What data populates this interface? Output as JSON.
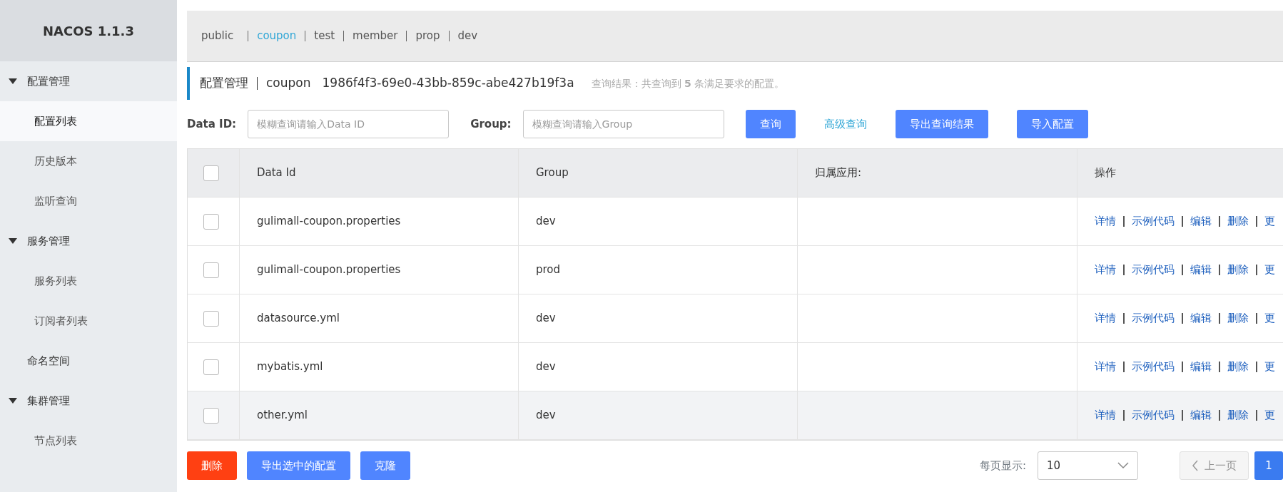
{
  "sidebar": {
    "title": "NACOS 1.1.3",
    "items": [
      {
        "label": "配置管理",
        "kind": "group",
        "expanded": true,
        "children": [
          {
            "label": "配置列表",
            "selected": true
          },
          {
            "label": "历史版本",
            "selected": false
          },
          {
            "label": "监听查询",
            "selected": false
          }
        ]
      },
      {
        "label": "服务管理",
        "kind": "group",
        "expanded": true,
        "children": [
          {
            "label": "服务列表",
            "selected": false
          },
          {
            "label": "订阅者列表",
            "selected": false
          }
        ]
      },
      {
        "label": "命名空间",
        "kind": "link",
        "selected": false
      },
      {
        "label": "集群管理",
        "kind": "group",
        "expanded": true,
        "children": [
          {
            "label": "节点列表",
            "selected": false
          }
        ]
      }
    ]
  },
  "namespaces": [
    {
      "label": "public",
      "selected": false
    },
    {
      "label": "coupon",
      "selected": true
    },
    {
      "label": "test",
      "selected": false
    },
    {
      "label": "member",
      "selected": false
    },
    {
      "label": "prop",
      "selected": false
    },
    {
      "label": "dev",
      "selected": false
    }
  ],
  "header": {
    "title": "配置管理",
    "namespace": "coupon",
    "namespace_id": "1986f4f3-69e0-43bb-859c-abe427b19f3a",
    "result": "查询结果：共查询到 **5** 条满足要求的配置。"
  },
  "filters": [
    {
      "label": "Data ID:",
      "placeholder": "模糊查询请输入Data ID"
    },
    {
      "label": "Group:",
      "placeholder": "模糊查询请输入Group"
    }
  ],
  "actions": [
    {
      "label": "查询",
      "kind": "primary"
    },
    {
      "label": "高级查询",
      "kind": "link"
    },
    {
      "label": "导出查询结果",
      "kind": "primary"
    },
    {
      "label": "导入配置",
      "kind": "primary"
    }
  ],
  "table": {
    "columns": [
      "Data Id",
      "Group",
      "归属应用:",
      "操作"
    ],
    "all_checked": false,
    "rows": [
      {
        "data_id": "gulimall-coupon.properties",
        "group": "dev",
        "checked": false,
        "hovered": false,
        "operations": [
          "详情",
          "示例代码",
          "编辑",
          "删除",
          "更"
        ]
      },
      {
        "data_id": "gulimall-coupon.properties",
        "group": "prod",
        "checked": false,
        "hovered": false,
        "operations": [
          "详情",
          "示例代码",
          "编辑",
          "删除",
          "更"
        ]
      },
      {
        "data_id": "datasource.yml",
        "group": "dev",
        "checked": false,
        "hovered": false,
        "operations": [
          "详情",
          "示例代码",
          "编辑",
          "删除",
          "更"
        ]
      },
      {
        "data_id": "mybatis.yml",
        "group": "dev",
        "checked": false,
        "hovered": false,
        "operations": [
          "详情",
          "示例代码",
          "编辑",
          "删除",
          "更"
        ]
      },
      {
        "data_id": "other.yml",
        "group": "dev",
        "checked": false,
        "hovered": true,
        "operations": [
          "详情",
          "示例代码",
          "编辑",
          "删除",
          "更"
        ]
      }
    ]
  },
  "bulk_actions": [
    {
      "label": "删除",
      "kind": "danger"
    },
    {
      "label": "导出选中的配置",
      "kind": "primary"
    },
    {
      "label": "克隆",
      "kind": "primary"
    }
  ],
  "pagination": {
    "page_size_label": "每页显示:",
    "page_size": "10",
    "prev_label": "上一页",
    "prev_disabled": true,
    "pages": [
      {
        "label": "1",
        "selected": true
      }
    ]
  }
}
